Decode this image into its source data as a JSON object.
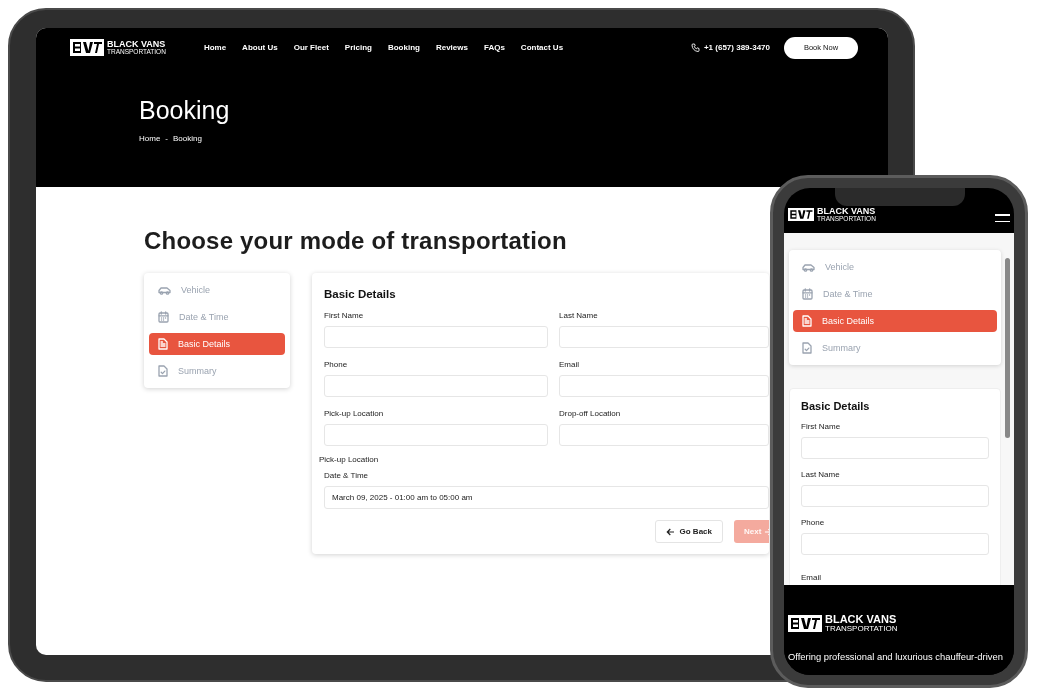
{
  "tablet": {
    "header": {
      "brand": {
        "name": "BLACK VANS",
        "tagline": "TRANSPORTATION"
      },
      "nav": [
        "Home",
        "About Us",
        "Our Fleet",
        "Pricing",
        "Booking",
        "Reviews",
        "FAQs",
        "Contact Us"
      ],
      "phone": "+1 (657) 389-3470",
      "cta": "Book Now"
    },
    "hero": {
      "title": "Booking",
      "breadcrumb": [
        "Home",
        "-",
        "Booking"
      ]
    },
    "heading": "Choose your mode of transportation",
    "steps": [
      {
        "label": "Vehicle",
        "kind": "car",
        "selected": false
      },
      {
        "label": "Date & Time",
        "kind": "calendar",
        "selected": false
      },
      {
        "label": "Basic Details",
        "kind": "document",
        "selected": true
      },
      {
        "label": "Summary",
        "kind": "check-document",
        "selected": false
      }
    ],
    "form": {
      "title": "Basic Details",
      "fields": [
        {
          "label": "First Name"
        },
        {
          "label": "Last Name"
        },
        {
          "label": "Phone"
        },
        {
          "label": "Email"
        },
        {
          "label": "Pick-up Location"
        },
        {
          "label": "Drop-off Location"
        }
      ],
      "stray_label": "Pick-up Location",
      "date_field": {
        "label": "Date & Time",
        "value": "March 09, 2025 - 01:00 am to 05:00 am"
      },
      "buttons": [
        {
          "label": "Go Back",
          "kind": "back"
        },
        {
          "label": "Next",
          "kind": "next",
          "disabled": true
        }
      ]
    }
  },
  "phone": {
    "brand": {
      "name": "BLACK VANS",
      "tagline": "TRANSPORTATION"
    },
    "steps": [
      {
        "label": "Vehicle",
        "kind": "car",
        "selected": false
      },
      {
        "label": "Date & Time",
        "kind": "calendar",
        "selected": false
      },
      {
        "label": "Basic Details",
        "kind": "document",
        "selected": true
      },
      {
        "label": "Summary",
        "kind": "check-document",
        "selected": false
      }
    ],
    "form": {
      "title": "Basic Details",
      "fields": [
        {
          "label": "First Name"
        },
        {
          "label": "Last Name"
        },
        {
          "label": "Phone"
        }
      ],
      "cut_label": "Email"
    },
    "footer": {
      "brand": {
        "name": "BLACK VANS",
        "tagline": "TRANSPORTATION"
      },
      "text": "Offering professional and luxurious chauffeur-driven"
    }
  }
}
